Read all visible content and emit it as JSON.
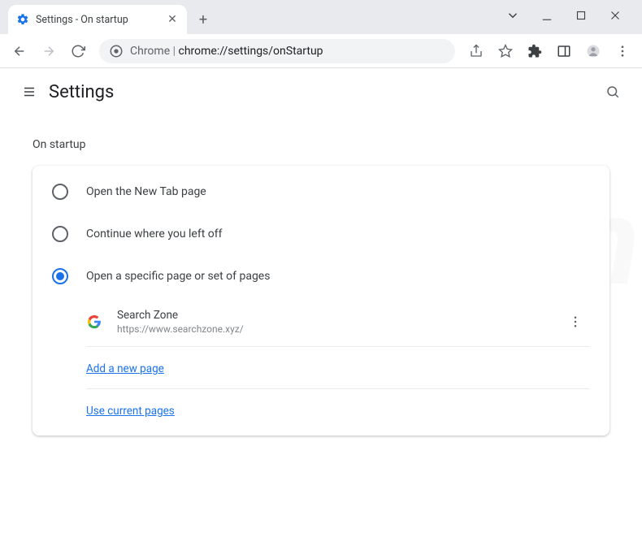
{
  "tab": {
    "title": "Settings - On startup"
  },
  "omnibox": {
    "prefix": "Chrome",
    "separator": " | ",
    "url": "chrome://settings/onStartup"
  },
  "header": {
    "title": "Settings"
  },
  "section": {
    "title": "On startup"
  },
  "options": {
    "newtab": "Open the New Tab page",
    "continue": "Continue where you left off",
    "specific": "Open a specific page or set of pages"
  },
  "pages": [
    {
      "name": "Search Zone",
      "url": "https://www.searchzone.xyz/"
    }
  ],
  "links": {
    "add": "Add a new page",
    "use_current": "Use current pages"
  },
  "colors": {
    "accent": "#1a73e8"
  }
}
